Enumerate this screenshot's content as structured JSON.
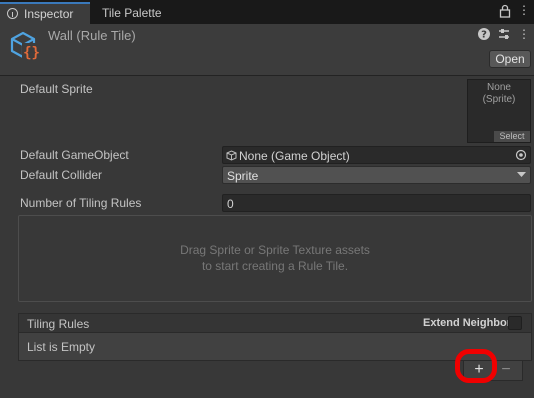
{
  "tabs": [
    {
      "label": "Inspector",
      "icon": "info-icon"
    },
    {
      "label": "Tile Palette"
    }
  ],
  "header": {
    "asset_name": "Wall (Rule Tile)",
    "open_label": "Open",
    "icons": [
      "lock-icon",
      "menu-icon",
      "help-icon",
      "preset-icon",
      "overflow-icon"
    ]
  },
  "fields": {
    "default_sprite": {
      "label": "Default Sprite",
      "value": "None\n(Sprite)",
      "select_label": "Select"
    },
    "default_gameobject": {
      "label": "Default GameObject",
      "value": "None (Game Object)"
    },
    "default_collider": {
      "label": "Default Collider",
      "value": "Sprite"
    },
    "tiling_rules_count": {
      "label": "Number of Tiling Rules",
      "value": "0"
    }
  },
  "drop_area": {
    "line1": "Drag Sprite or Sprite Texture assets",
    "line2": "to start creating a Rule Tile."
  },
  "tiling_rules": {
    "title": "Tiling Rules",
    "extend_neighbor_label": "Extend Neighbor",
    "extend_neighbor_checked": false,
    "empty_text": "List is Empty",
    "add_label": "+",
    "remove_label": "−"
  },
  "colors": {
    "accent_tab": "#3a79bb",
    "asset_icon": "#4fa3e0",
    "asset_icon_braces": "#e06a3a",
    "highlight": "#f00000"
  }
}
